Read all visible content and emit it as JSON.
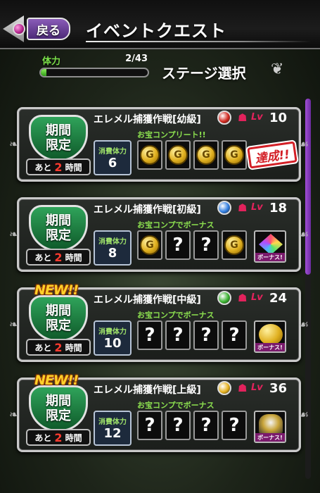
{
  "header": {
    "back_label": "戻る",
    "title": "イベントクエスト"
  },
  "stamina": {
    "label": "体力",
    "value": "2/43",
    "fraction": 0.05
  },
  "stage_select_label": "ステージ選択",
  "quests": [
    {
      "badge_new": "",
      "limited_line1": "期間",
      "limited_line2": "限定",
      "remain_prefix": "あと",
      "remain_num": "2",
      "remain_unit": "時間",
      "name": "エレメル捕獲作戦[幼級]",
      "element_icon": "fire-element-icon",
      "element_color": "#d2281e",
      "lv_label": "Lv",
      "level": "10",
      "stamina_label": "消費体力",
      "stamina_cost": "6",
      "treasure_label": "お宝コンプリート!!",
      "slots": [
        "coin",
        "coin",
        "coin",
        "coin"
      ],
      "coin_letter": "G",
      "reward_type": "stamp",
      "reward_text": "達成!!"
    },
    {
      "badge_new": "",
      "limited_line1": "期間",
      "limited_line2": "限定",
      "remain_prefix": "あと",
      "remain_num": "2",
      "remain_unit": "時間",
      "name": "エレメル捕獲作戦[初級]",
      "element_icon": "water-element-icon",
      "element_color": "#2f7de0",
      "lv_label": "Lv",
      "level": "18",
      "stamina_label": "消費体力",
      "stamina_cost": "8",
      "treasure_label": "お宝コンプでボーナス",
      "slots": [
        "coin",
        "unknown",
        "unknown",
        "coin"
      ],
      "coin_letter": "G",
      "unknown_glyph": "?",
      "reward_type": "crystal",
      "reward_text": "ボーナス!"
    },
    {
      "badge_new": "NEW!!",
      "limited_line1": "期間",
      "limited_line2": "限定",
      "remain_prefix": "あと",
      "remain_num": "2",
      "remain_unit": "時間",
      "name": "エレメル捕獲作戦[中級]",
      "element_icon": "wind-element-icon",
      "element_color": "#39b32f",
      "lv_label": "Lv",
      "level": "24",
      "stamina_label": "消費体力",
      "stamina_cost": "10",
      "treasure_label": "お宝コンプでボーナス",
      "slots": [
        "unknown",
        "unknown",
        "unknown",
        "unknown"
      ],
      "unknown_glyph": "?",
      "coin_letter": "G",
      "reward_type": "coin",
      "reward_text": "ボーナス!"
    },
    {
      "badge_new": "NEW!!",
      "limited_line1": "期間",
      "limited_line2": "限定",
      "remain_prefix": "あと",
      "remain_num": "2",
      "remain_unit": "時間",
      "name": "エレメル捕獲作戦[上級]",
      "element_icon": "light-element-icon",
      "element_color": "#e6b21e",
      "lv_label": "Lv",
      "level": "36",
      "stamina_label": "消費体力",
      "stamina_cost": "12",
      "treasure_label": "お宝コンプでボーナス",
      "slots": [
        "unknown",
        "unknown",
        "unknown",
        "unknown"
      ],
      "unknown_glyph": "?",
      "coin_letter": "G",
      "reward_type": "monster",
      "reward_text": "ボーナス!"
    }
  ]
}
